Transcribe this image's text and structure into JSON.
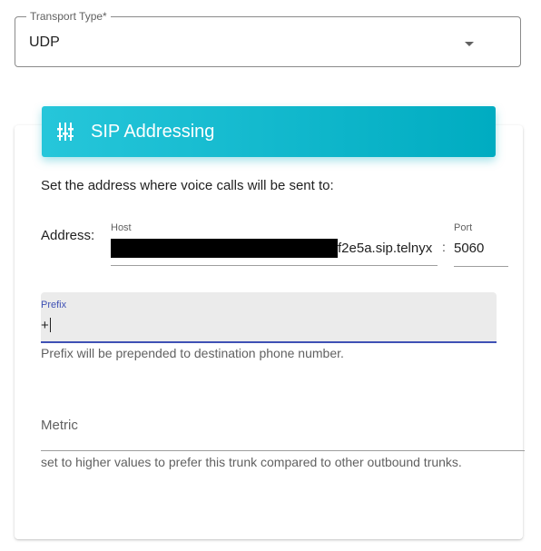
{
  "transport": {
    "label": "Transport Type*",
    "value": "UDP",
    "dropdown_icon": "chevron-down-icon"
  },
  "sip": {
    "title": "SIP Addressing",
    "header_icon": "tune-icon",
    "header_color": "#00acc1",
    "description": "Set the address where voice calls will be sent to:",
    "address_label": "Address:",
    "host_label": "Host",
    "host_value": "f2e5a.sip.telnyx",
    "separator": ":",
    "port_label": "Port",
    "port_value": "5060",
    "prefix_label": "Prefix",
    "prefix_value": "+",
    "prefix_helper": "Prefix will be prepended to destination phone number.",
    "metric_label": "Metric",
    "metric_helper": "set to higher values to prefer this trunk compared to other outbound trunks."
  }
}
